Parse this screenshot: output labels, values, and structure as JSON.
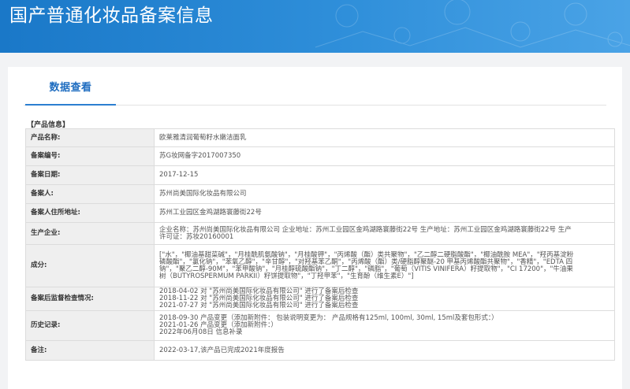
{
  "header": {
    "title": "国产普通化妆品备案信息"
  },
  "tabs": [
    {
      "label": "数据查看"
    }
  ],
  "section_title": "【产品信息】",
  "rows": [
    {
      "label": "产品名称:",
      "lines": [
        "欧莱雅清润葡萄籽水嫩洁面乳"
      ]
    },
    {
      "label": "备案编号:",
      "lines": [
        "苏G妆网备字2017007350"
      ]
    },
    {
      "label": "备案日期:",
      "lines": [
        "2017-12-15"
      ]
    },
    {
      "label": "备案人:",
      "lines": [
        "苏州尚美国际化妆品有限公司"
      ]
    },
    {
      "label": "备案人住所地址:",
      "lines": [
        "苏州工业园区金鸡湖路寰藤街22号"
      ]
    },
    {
      "label": "生产企业:",
      "lines": [
        "企业名称：苏州尚美国际化妆品有限公司 企业地址：苏州工业园区金鸡湖路寰藤街22号 生产地址：苏州工业园区金鸡湖路寰藤街22号 生产",
        "许可证：苏妆20160001"
      ]
    },
    {
      "label": "成分:",
      "lines": [
        "[\"水\"，\"椰油基甜菜碱\"，\"月桂酰肌氨酸钠\"，\"月桂酸钾\"，\"丙烯酸（酯）类共聚物\"，\"乙二醇二硬脂酸酯\"，\"椰油酰胺 MEA\"，\"羟丙基淀粉",
        "磷酸酯\"，\"氯化钠\"，\"苯氧乙醇\"，\"辛甘醇\"，\"对羟基苯乙酮\"，\"丙烯酸（酯）类/硬脂醇聚醚-20 甲基丙烯酸酯共聚物\"，\"香精\"，\"EDTA 四",
        "钠\"，\"聚乙二醇-90M\"，\"苯甲酸钠\"，\"月桂醇硫酸酯钠\"，\"丁二醇\"，\"磷脂\"，\"葡萄（VITIS VINIFERA）籽提取物\"，\"CI 17200\"，\"牛油果",
        "树（BUTYROSPERMUM PARKII）籽饼提取物\"，\"丁羟甲苯\"，\"生育酚（维生素E）\"]"
      ]
    },
    {
      "label": "备案后监督检查情况:",
      "lines": [
        "2018-04-02 对 \"苏州尚美国际化妆品有限公司\" 进行了备案后检查",
        "2018-11-22 对 \"苏州尚美国际化妆品有限公司\" 进行了备案后检查",
        "2021-07-27 对 \"苏州尚美国际化妆品有限公司\" 进行了备案后检查"
      ]
    },
    {
      "label": "历史记录:",
      "lines": [
        "2018-09-30 产品变更（添加新附件： 包装说明变更为： 产品规格有125ml, 100ml, 30ml, 15ml及套包形式：）",
        "2021-01-26 产品变更（添加新附件：）",
        "2022年06月08日 信息补录"
      ]
    },
    {
      "label": "备注:",
      "lines": [
        "2022-03-17,该产品已完成2021年度报告"
      ]
    }
  ]
}
